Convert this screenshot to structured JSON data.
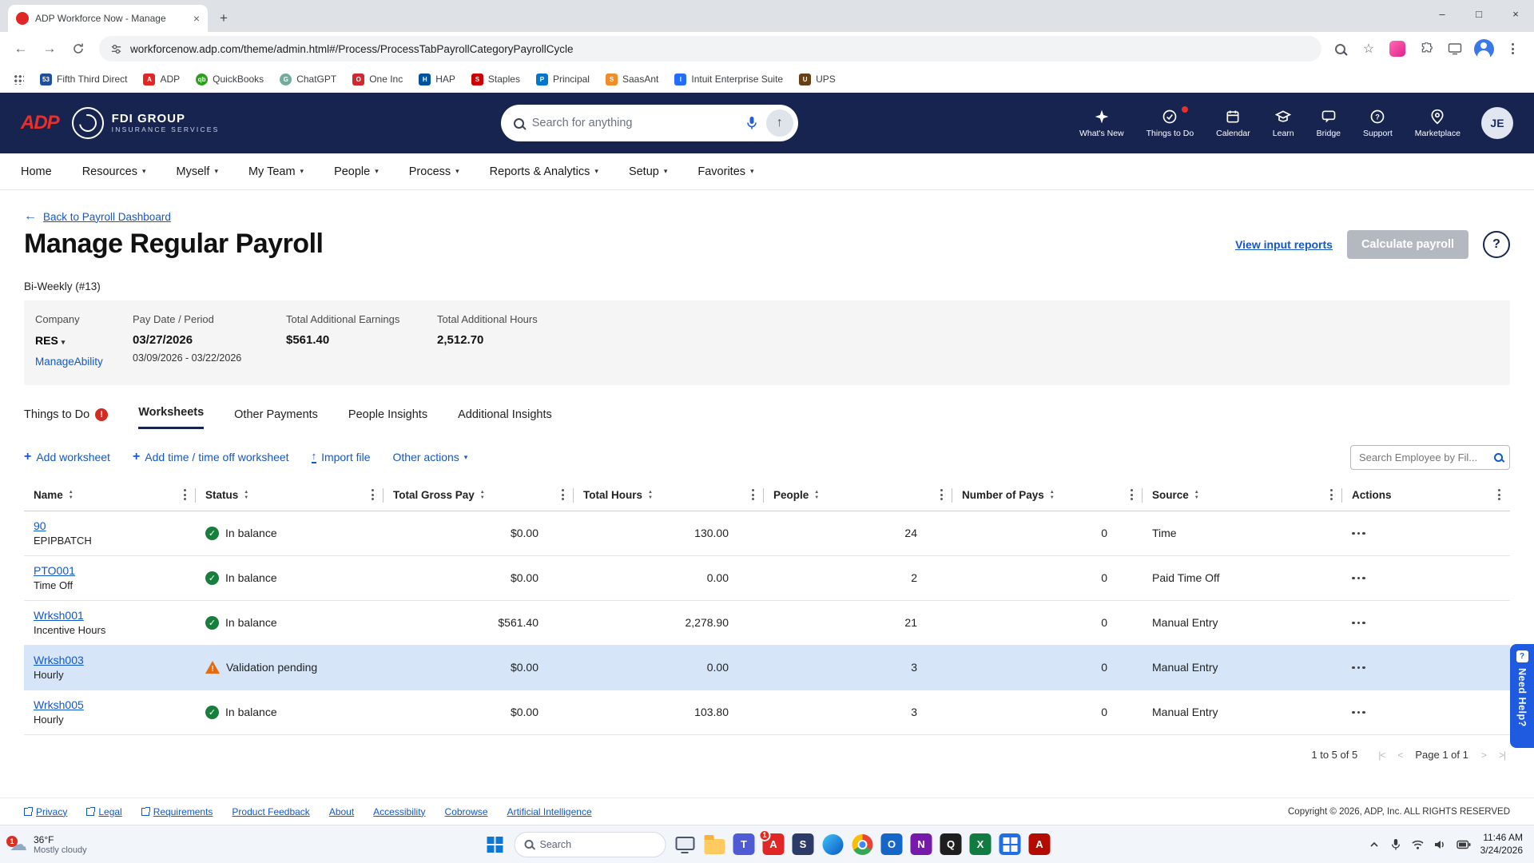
{
  "icons": {
    "caret": "▾",
    "back_arrow": "←",
    "fwd_arrow": "→",
    "left_arrow": "←",
    "up_arrow": "↑",
    "plus": "+",
    "close": "×",
    "minimize": "–",
    "maximize": "□",
    "sort_up": "▲",
    "sort_down": "▼",
    "check": "✓",
    "question": "?",
    "star": "☆",
    "cloud": "☁",
    "page_first": "|<",
    "page_prev": "<",
    "page_next": ">",
    "page_last": ">|"
  },
  "browser": {
    "tab_title": "ADP Workforce Now - Manage",
    "url": "workforcenow.adp.com/theme/admin.html#/Process/ProcessTabPayrollCategoryPayrollCycle",
    "bookmarks": [
      "Fifth Third Direct",
      "ADP",
      "QuickBooks",
      "ChatGPT",
      "One Inc",
      "HAP",
      "Staples",
      "Principal",
      "SaasAnt",
      "Intuit Enterprise Suite",
      "UPS"
    ]
  },
  "adp_header": {
    "logo_text": "ADP",
    "brand_line1": "FDI GROUP",
    "brand_line2": "INSURANCE SERVICES",
    "search_placeholder": "Search for anything",
    "menu": [
      "What's New",
      "Things to Do",
      "Calendar",
      "Learn",
      "Bridge",
      "Support",
      "Marketplace"
    ],
    "avatar": "JE"
  },
  "nav": [
    "Home",
    "Resources",
    "Myself",
    "My Team",
    "People",
    "Process",
    "Reports & Analytics",
    "Setup",
    "Favorites"
  ],
  "page": {
    "back_link": "Back to Payroll Dashboard",
    "title": "Manage Regular Payroll",
    "view_input_reports": "View input reports",
    "calculate_payroll": "Calculate payroll",
    "cycle_label": "Bi-Weekly (#13)",
    "summary": {
      "company_label": "Company",
      "company_value": "RES",
      "company_link": "ManageAbility",
      "pay_date_label": "Pay Date / Period",
      "pay_date": "03/27/2026",
      "pay_period": "03/09/2026 - 03/22/2026",
      "earnings_label": "Total Additional Earnings",
      "earnings_value": "$561.40",
      "hours_label": "Total Additional Hours",
      "hours_value": "2,512.70"
    },
    "tabs": [
      {
        "label": "Things to Do",
        "badge": "!"
      },
      {
        "label": "Worksheets"
      },
      {
        "label": "Other Payments"
      },
      {
        "label": "People Insights"
      },
      {
        "label": "Additional Insights"
      }
    ],
    "toolbar": {
      "add_worksheet": "Add worksheet",
      "add_time": "Add time / time off worksheet",
      "import_file": "Import file",
      "other_actions": "Other actions",
      "search_placeholder": "Search Employee by Fil..."
    },
    "table": {
      "columns": [
        "Name",
        "Status",
        "Total Gross Pay",
        "Total Hours",
        "People",
        "Number of Pays",
        "Source",
        "Actions"
      ],
      "rows": [
        {
          "name": "90",
          "subtitle": "EPIPBATCH",
          "status": "In balance",
          "gross": "$0.00",
          "hours": "130.00",
          "people": "24",
          "pays": "0",
          "source": "Time"
        },
        {
          "name": "PTO001",
          "subtitle": "Time Off",
          "status": "In balance",
          "gross": "$0.00",
          "hours": "0.00",
          "people": "2",
          "pays": "0",
          "source": "Paid Time Off"
        },
        {
          "name": "Wrksh001",
          "subtitle": "Incentive Hours",
          "status": "In balance",
          "gross": "$561.40",
          "hours": "2,278.90",
          "people": "21",
          "pays": "0",
          "source": "Manual Entry"
        },
        {
          "name": "Wrksh003",
          "subtitle": "Hourly",
          "status": "Validation pending",
          "gross": "$0.00",
          "hours": "0.00",
          "people": "3",
          "pays": "0",
          "source": "Manual Entry"
        },
        {
          "name": "Wrksh005",
          "subtitle": "Hourly",
          "status": "In balance",
          "gross": "$0.00",
          "hours": "103.80",
          "people": "3",
          "pays": "0",
          "source": "Manual Entry"
        }
      ]
    },
    "pagination": {
      "range": "1 to 5 of 5",
      "page": "Page 1 of 1"
    },
    "need_help": "Need Help?"
  },
  "footer": {
    "links": [
      "Privacy",
      "Legal",
      "Requirements",
      "Product Feedback",
      "About",
      "Accessibility",
      "Cobrowse",
      "Artificial Intelligence"
    ],
    "copyright": "Copyright © 2026, ADP, Inc. ALL RIGHTS RESERVED"
  },
  "taskbar": {
    "weather_temp": "36°F",
    "weather_desc": "Mostly cloudy",
    "weather_badge": "1",
    "app_badge": "1",
    "search_placeholder": "Search",
    "time": "11:46 AM",
    "date": "3/24/2026"
  }
}
